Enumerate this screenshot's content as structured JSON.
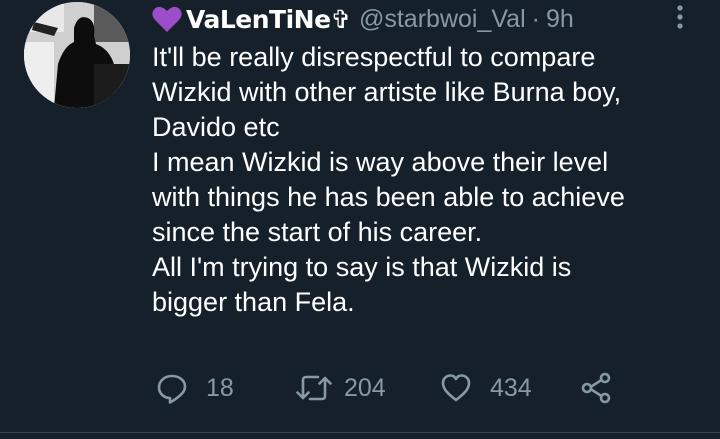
{
  "tweet": {
    "author": {
      "emoji_icon": "purple-heart-icon",
      "display_name": "VaLenTiNe✞",
      "handle": "@starbwoi_Val",
      "separator": "·",
      "time": "9h"
    },
    "more_icon": "more-vertical-icon",
    "text_lines": [
      "It'll be really disrespectful to compare",
      "Wizkid with other artiste like Burna boy,",
      "Davido etc",
      "I mean Wizkid is way above their level",
      "with things he has been able to achieve",
      "since the start of his career.",
      "All I'm trying to say is that Wizkid is",
      "bigger than Fela."
    ],
    "actions": {
      "reply": {
        "icon": "reply-icon",
        "count": "18"
      },
      "retweet": {
        "icon": "retweet-icon",
        "count": "204"
      },
      "like": {
        "icon": "heart-icon",
        "count": "434"
      },
      "share": {
        "icon": "share-icon"
      }
    }
  },
  "colors": {
    "background": "#15202b",
    "text": "#ffffff",
    "secondary_text": "#8899a6",
    "emoji": "#9b4dca"
  }
}
